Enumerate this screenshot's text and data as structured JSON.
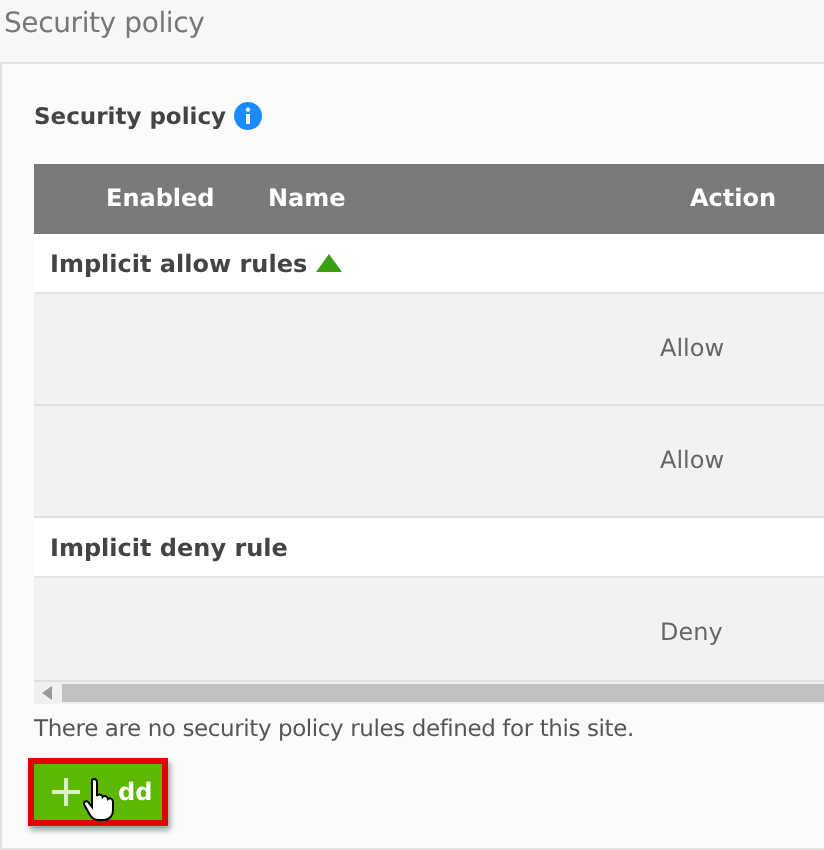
{
  "page_title": "Security policy",
  "section": {
    "title": "Security policy"
  },
  "table": {
    "columns": [
      "Enabled",
      "Name",
      "Action"
    ],
    "groups": [
      {
        "label": "Implicit allow rules",
        "expanded": true,
        "rows": [
          {
            "action": "Allow"
          },
          {
            "action": "Allow"
          }
        ]
      },
      {
        "label": "Implicit deny rule",
        "rows": [
          {
            "action": "Deny"
          }
        ]
      }
    ]
  },
  "message": "There are no security policy rules defined for this site.",
  "add_button": {
    "label": "dd"
  }
}
